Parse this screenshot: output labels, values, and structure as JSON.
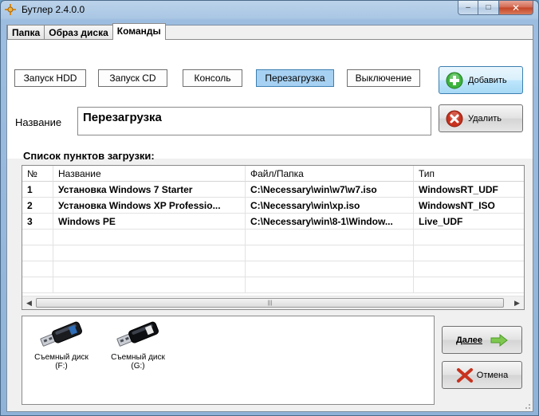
{
  "window": {
    "title": "Бутлер 2.4.0.0"
  },
  "caption": {
    "minimize": "–",
    "maximize": "□",
    "close": "✕"
  },
  "tabs": [
    {
      "label": "Папка"
    },
    {
      "label": "Образ диска"
    },
    {
      "label": "Команды"
    }
  ],
  "commands": {
    "buttons": [
      {
        "label": "Запуск HDD"
      },
      {
        "label": "Запуск CD"
      },
      {
        "label": "Консоль"
      },
      {
        "label": "Перезагрузка"
      },
      {
        "label": "Выключение"
      }
    ],
    "add_label": "Добавить",
    "delete_label": "Удалить",
    "name_label": "Название",
    "name_value": "Перезагрузка"
  },
  "boot_list": {
    "label": "Список пунктов загрузки:",
    "columns": [
      "№",
      "Название",
      "Файл/Папка",
      "Тип"
    ],
    "rows": [
      [
        "1",
        "Установка Windows 7 Starter",
        "C:\\Necessary\\win\\w7\\w7.iso",
        "WindowsRT_UDF"
      ],
      [
        "2",
        "Установка Windows XP Professio...",
        "C:\\Necessary\\win\\xp.iso",
        "WindowsNT_ISO"
      ],
      [
        "3",
        "Windows PE",
        "C:\\Necessary\\win\\8-1\\Window...",
        "Live_UDF"
      ]
    ]
  },
  "drives": [
    {
      "line1": "Съемный диск",
      "line2": "(F:)"
    },
    {
      "line1": "Съемный диск",
      "line2": "(G:)"
    }
  ],
  "next_label": "Далее",
  "cancel_label": "Отмена",
  "colors": {
    "active_command": "#a7d1f2",
    "add_icon": "#3db33d",
    "delete_icon": "#c8321e",
    "next_arrow": "#7ec850"
  }
}
